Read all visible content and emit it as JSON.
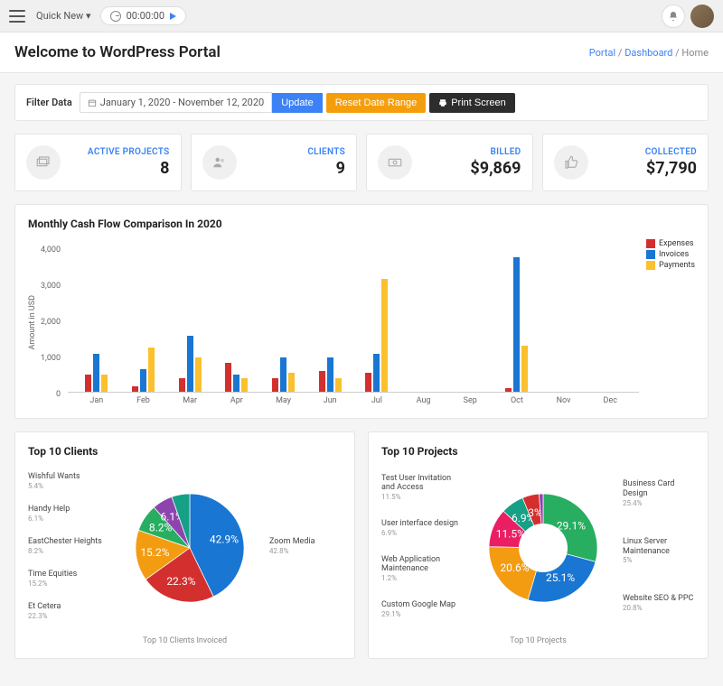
{
  "topbar": {
    "quick_new": "Quick New ▾",
    "timer": "00:00:00"
  },
  "header": {
    "title": "Welcome to WordPress Portal",
    "breadcrumb": {
      "portal": "Portal",
      "dashboard": "Dashboard",
      "home": "Home"
    }
  },
  "filter": {
    "label": "Filter Data",
    "date_range": "January 1, 2020 - November 12, 2020",
    "update": "Update",
    "reset": "Reset Date Range",
    "print": "Print Screen"
  },
  "cards": {
    "active_projects": {
      "label": "ACTIVE PROJECTS",
      "value": "8"
    },
    "clients": {
      "label": "CLIENTS",
      "value": "9"
    },
    "billed": {
      "label": "BILLED",
      "value": "$9,869"
    },
    "collected": {
      "label": "COLLECTED",
      "value": "$7,790"
    }
  },
  "cashflow": {
    "title": "Monthly Cash Flow Comparison In 2020",
    "ylabel": "Amount in USD",
    "legend": {
      "expenses": "Expenses",
      "invoices": "Invoices",
      "payments": "Payments"
    }
  },
  "top_clients": {
    "title": "Top 10 Clients",
    "caption": "Top 10 Clients Invoiced",
    "left": [
      {
        "name": "Wishful Wants",
        "pct": "5.4%"
      },
      {
        "name": "Handy Help",
        "pct": "6.1%"
      },
      {
        "name": "EastChester Heights",
        "pct": "8.2%"
      },
      {
        "name": "Time Equities",
        "pct": "15.2%"
      },
      {
        "name": "Et Cetera",
        "pct": "22.3%"
      }
    ],
    "right": [
      {
        "name": "Zoom Media",
        "pct": "42.8%"
      }
    ],
    "slice_labels": {
      "a": "6.1%",
      "b": "8.2%",
      "c": "15.2%",
      "d": "22.3%",
      "e": "42.9%"
    }
  },
  "top_projects": {
    "title": "Top 10 Projects",
    "caption": "Top 10 Projects",
    "left": [
      {
        "name": "Test User Invitation and Access",
        "pct": "11.5%"
      },
      {
        "name": "User interface design",
        "pct": "6.9%"
      },
      {
        "name": "Web Application Maintenance",
        "pct": "1.2%"
      },
      {
        "name": "Custom Google Map",
        "pct": "29.1%"
      }
    ],
    "right": [
      {
        "name": "Business Card Design",
        "pct": "25.4%"
      },
      {
        "name": "Linux Server Maintenance",
        "pct": "5%"
      },
      {
        "name": "Website SEO &amp; PPC",
        "pct": "20.8%"
      }
    ],
    "slice_labels": {
      "a": "11.5%",
      "b": "6.9%",
      "c": "29.1%",
      "d": "20.6%",
      "e": "3%",
      "f": "25.1%"
    }
  },
  "chart_data": {
    "cashflow": {
      "type": "bar",
      "title": "Monthly Cash Flow Comparison In 2020",
      "ylabel": "Amount in USD",
      "ylim": [
        0,
        4000
      ],
      "categories": [
        "Jan",
        "Feb",
        "Mar",
        "Apr",
        "May",
        "Jun",
        "Jul",
        "Aug",
        "Sep",
        "Oct",
        "Nov",
        "Dec"
      ],
      "series": [
        {
          "name": "Expenses",
          "color": "#d32f2f",
          "values": [
            450,
            150,
            350,
            750,
            350,
            550,
            500,
            0,
            0,
            100,
            0,
            0
          ]
        },
        {
          "name": "Invoices",
          "color": "#1976d2",
          "values": [
            1000,
            600,
            1450,
            450,
            900,
            900,
            1000,
            0,
            0,
            3500,
            0,
            0
          ]
        },
        {
          "name": "Payments",
          "color": "#fbc02d",
          "values": [
            450,
            1150,
            900,
            350,
            500,
            350,
            2950,
            0,
            0,
            1200,
            0,
            0
          ]
        }
      ]
    },
    "top_clients": {
      "type": "pie",
      "title": "Top 10 Clients Invoiced",
      "series": [
        {
          "name": "Zoom Media",
          "value": 42.8
        },
        {
          "name": "Et Cetera",
          "value": 22.3
        },
        {
          "name": "Time Equities",
          "value": 15.2
        },
        {
          "name": "EastChester Heights",
          "value": 8.2
        },
        {
          "name": "Handy Help",
          "value": 6.1
        },
        {
          "name": "Wishful Wants",
          "value": 5.4
        }
      ]
    },
    "top_projects": {
      "type": "pie",
      "title": "Top 10 Projects",
      "series": [
        {
          "name": "Custom Google Map",
          "value": 29.1
        },
        {
          "name": "Business Card Design",
          "value": 25.4
        },
        {
          "name": "Website SEO & PPC",
          "value": 20.8
        },
        {
          "name": "Test User Invitation and Access",
          "value": 11.5
        },
        {
          "name": "User interface design",
          "value": 6.9
        },
        {
          "name": "Linux Server Maintenance",
          "value": 5.0
        },
        {
          "name": "Web Application Maintenance",
          "value": 1.2
        }
      ]
    }
  }
}
